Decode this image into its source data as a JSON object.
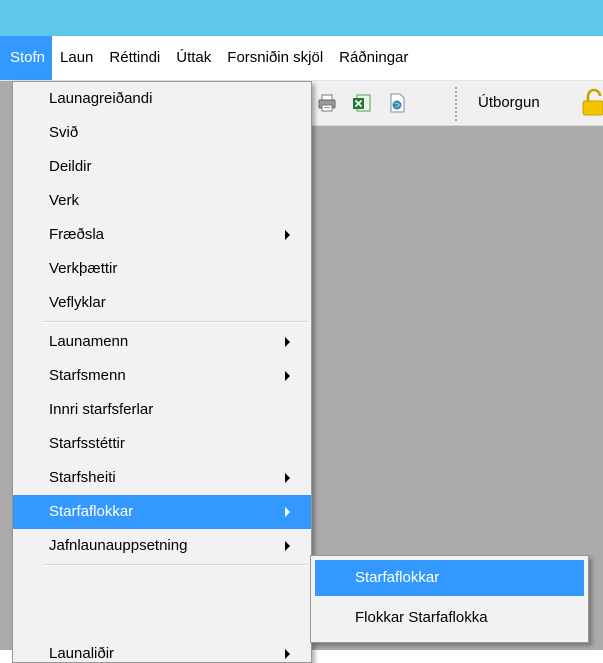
{
  "colors": {
    "title_bar": "#5fc6ec",
    "highlight": "#3399ff",
    "menu_background": "#f2f2f2",
    "work_area": "#ababab"
  },
  "menubar": {
    "items": [
      {
        "label": "Stofn",
        "active": true
      },
      {
        "label": "Laun"
      },
      {
        "label": "Réttindi"
      },
      {
        "label": "Úttak"
      },
      {
        "label": "Forsniðin skjöl"
      },
      {
        "label": "Ráðningar"
      }
    ]
  },
  "toolbar": {
    "icons": [
      "printer-icon",
      "excel-export-icon",
      "web-document-icon",
      "lock-icon"
    ],
    "label": "Útborgun"
  },
  "stofn_menu": {
    "items": [
      {
        "label": "Launagreiðandi"
      },
      {
        "label": "Svið"
      },
      {
        "label": "Deildir"
      },
      {
        "label": "Verk"
      },
      {
        "label": "Fræðsla",
        "submenu": true
      },
      {
        "label": "Verkþættir"
      },
      {
        "label": "Veflyklar"
      },
      {
        "label": "Launamenn",
        "submenu": true
      },
      {
        "label": "Starfsmenn",
        "submenu": true
      },
      {
        "label": "Innri starfsferlar"
      },
      {
        "label": "Starfsstéttir"
      },
      {
        "label": "Starfsheiti",
        "submenu": true
      },
      {
        "label": "Starfaflokkar",
        "submenu": true,
        "highlighted": true
      },
      {
        "label": "Jafnlaunauppsetning",
        "submenu": true
      },
      {
        "label": "Launaliðir",
        "submenu": true
      }
    ]
  },
  "starfaflokkar_submenu": {
    "items": [
      {
        "label": "Starfaflokkar",
        "highlighted": true
      },
      {
        "label": "Flokkar Starfaflokka"
      }
    ]
  }
}
